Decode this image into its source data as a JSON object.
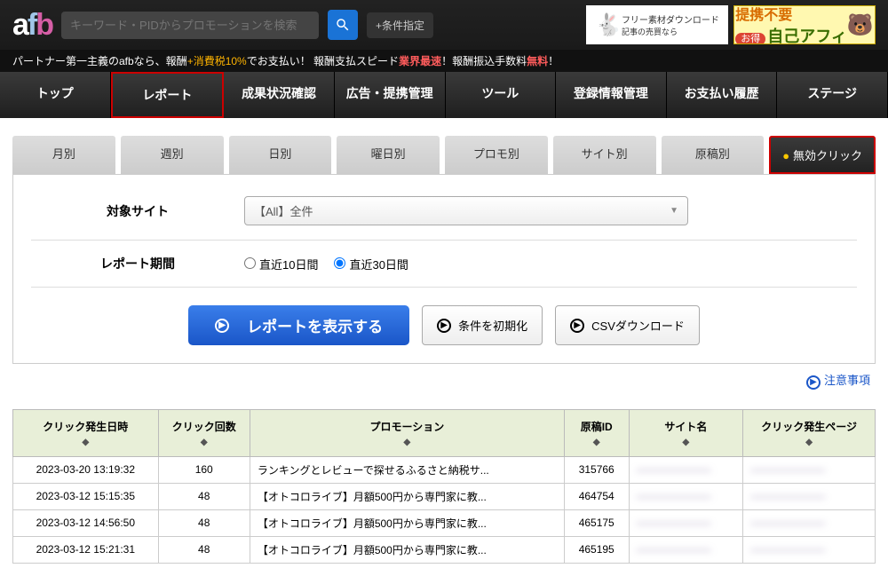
{
  "header": {
    "logo": {
      "a": "a",
      "f": "f",
      "b": "b"
    },
    "search_placeholder": "キーワード・PIDからプロモーションを検索",
    "condition_btn": "+条件指定",
    "ad1": {
      "line1": "フリー素材ダウンロード",
      "line2": "記事の売買なら"
    },
    "ad2": {
      "top": "提携不要",
      "badge": "お得",
      "main": "自己アフィ"
    }
  },
  "tagline": {
    "t1": "パートナー第一主義のafbなら、報酬",
    "t2": "+消費税10%",
    "t3": "でお支払い！ 報酬支払スピード",
    "t4": "業界最速",
    "t5": "！報酬振込手数料",
    "t6": "無料",
    "t7": "！"
  },
  "nav": [
    "トップ",
    "レポート",
    "成果状況確認",
    "広告・提携管理",
    "ツール",
    "登録情報管理",
    "お支払い履歴",
    "ステージ"
  ],
  "nav_active_index": 1,
  "subtabs": [
    "月別",
    "週別",
    "日別",
    "曜日別",
    "プロモ別",
    "サイト別",
    "原稿別",
    "無効クリック"
  ],
  "subtab_active_index": 7,
  "filters": {
    "site_label": "対象サイト",
    "site_value": "【All】全件",
    "period_label": "レポート期間",
    "period_options": [
      "直近10日間",
      "直近30日間"
    ],
    "period_selected_index": 1
  },
  "buttons": {
    "show_report": "レポートを表示する",
    "reset": "条件を初期化",
    "csv": "CSVダウンロード",
    "note": "注意事項"
  },
  "table": {
    "headers": [
      "クリック発生日時",
      "クリック回数",
      "プロモーション",
      "原稿ID",
      "サイト名",
      "クリック発生ページ"
    ],
    "rows": [
      {
        "dt": "2023-03-20 13:19:32",
        "clicks": 160,
        "promo": "ランキングとレビューで探せるふるさと納税サ...",
        "id": "315766",
        "site": "———————",
        "page": "———————"
      },
      {
        "dt": "2023-03-12 15:15:35",
        "clicks": 48,
        "promo": "【オトコロライブ】月額500円から専門家に教...",
        "id": "464754",
        "site": "———————",
        "page": "———————"
      },
      {
        "dt": "2023-03-12 14:56:50",
        "clicks": 48,
        "promo": "【オトコロライブ】月額500円から専門家に教...",
        "id": "465175",
        "site": "———————",
        "page": "———————"
      },
      {
        "dt": "2023-03-12 15:21:31",
        "clicks": 48,
        "promo": "【オトコロライブ】月額500円から専門家に教...",
        "id": "465195",
        "site": "———————",
        "page": "———————"
      }
    ]
  }
}
